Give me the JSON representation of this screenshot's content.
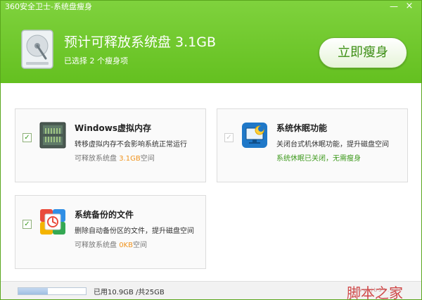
{
  "window": {
    "title": "360安全卫士-系统盘瘦身",
    "minimize_label": "—",
    "close_label": "×"
  },
  "header": {
    "headline": "预计可释放系统盘 3.1GB",
    "subline": "已选择 2 个瘦身项",
    "cta_label": "立即瘦身",
    "icon": "hard-disk-icon",
    "accent_color": "#6cc62a"
  },
  "cards": [
    {
      "title": "Windows虚拟内存",
      "desc": "转移虚拟内存不会影响系统正常运行",
      "sub_prefix": "可释放系统盘 ",
      "sub_value": "3.1GB",
      "sub_suffix": "空间",
      "checked": true,
      "icon": "memory-chip-icon"
    },
    {
      "title": "系统休眠功能",
      "desc": "关闭台式机休眠功能，提升磁盘空间",
      "status": "系统休眠已关闭，无需瘦身",
      "checked": true,
      "disabled": true,
      "icon": "hibernate-monitor-icon"
    },
    {
      "title": "系统备份的文件",
      "desc": "删除自动备份区的文件，提升磁盘空间",
      "sub_prefix": "可释放系统盘 ",
      "sub_value": "0KB",
      "sub_suffix": "空间",
      "checked": true,
      "icon": "backup-files-icon"
    }
  ],
  "footer": {
    "usage_text": "已用10.9GB /共25GB",
    "usage_fraction": 0.436,
    "watermark": "脚本之家",
    "watermark_url": "www.jb51.net"
  }
}
